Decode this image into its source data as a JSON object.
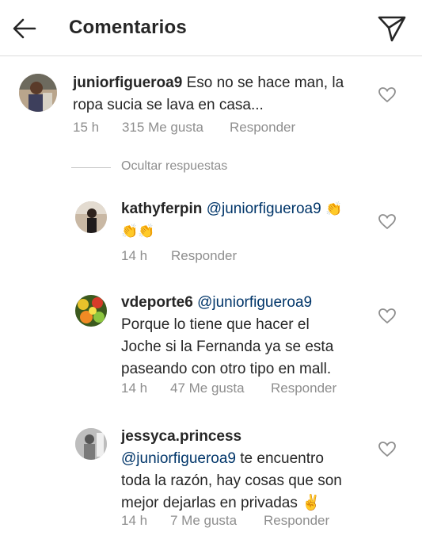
{
  "header": {
    "title": "Comentarios"
  },
  "comments": [
    {
      "username": "juniorfigueroa9",
      "text_line1": "Eso no se hace man, la",
      "text_line2": "ropa sucia se lava en casa...",
      "time": "15 h",
      "likes": "315 Me gusta",
      "reply": "Responder"
    }
  ],
  "hide_replies": "Ocultar respuestas",
  "replies": [
    {
      "username": "kathyferpin",
      "mention": "@juniorfigueroa9",
      "emoji_line1": "👏",
      "emoji_line2": "👏👏",
      "time": "14 h",
      "reply": "Responder"
    },
    {
      "username": "vdeporte6",
      "mention": "@juniorfigueroa9",
      "text_line1": "Porque lo tiene que hacer el",
      "text_line2": "Joche si la Fernanda ya se esta",
      "text_line3": "paseando con otro tipo en mall.",
      "time": "14 h",
      "likes": "47 Me gusta",
      "reply": "Responder"
    },
    {
      "username": "jessyca.princess",
      "mention": "@juniorfigueroa9",
      "text_line1": "te encuentro",
      "text_line2": "toda la razón, hay cosas que son",
      "text_line3": "mejor dejarlas en privadas ✌",
      "time": "14 h",
      "likes": "7 Me gusta",
      "reply": "Responder"
    }
  ]
}
